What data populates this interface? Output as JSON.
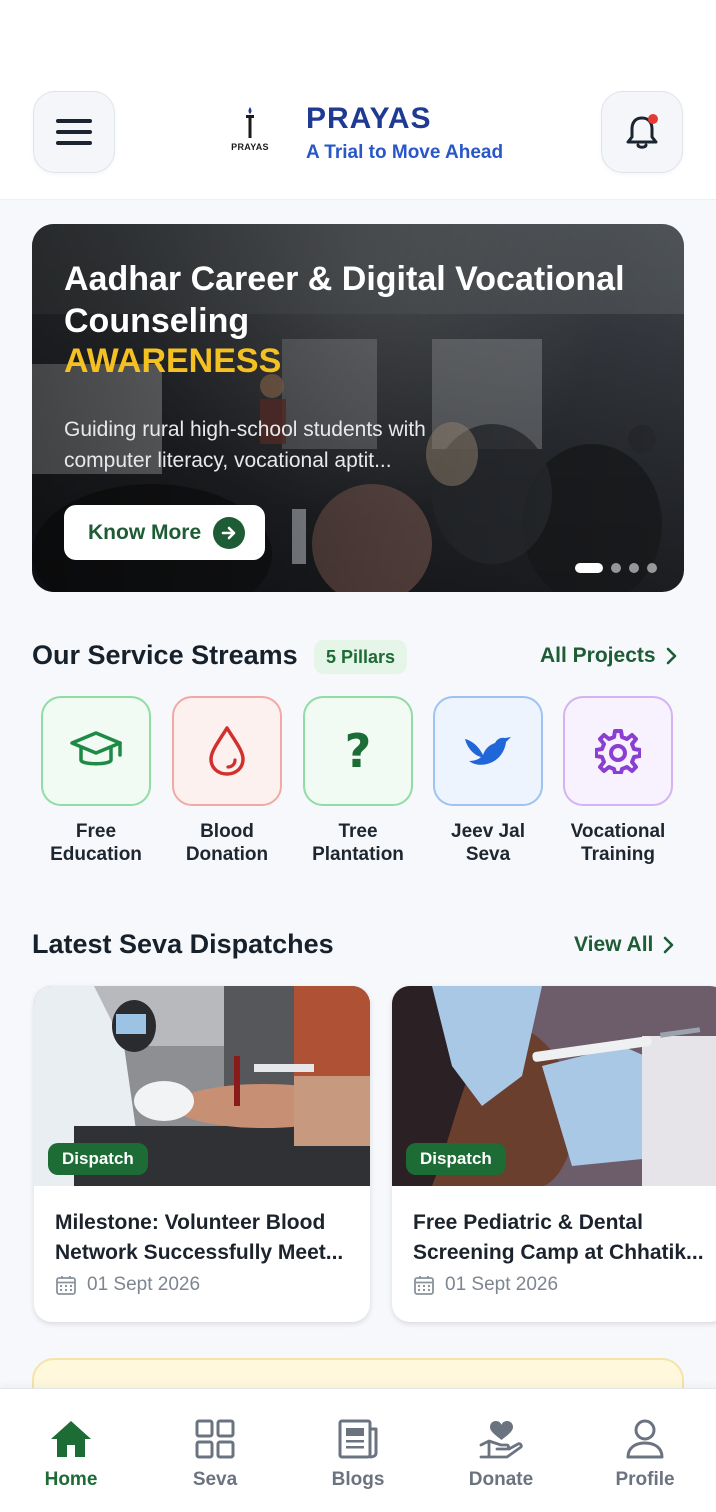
{
  "header": {
    "logo_text": "PRAYAS",
    "title": "PRAYAS",
    "subtitle": "A Trial to Move Ahead"
  },
  "hero": {
    "title": "Aadhar Career & Digital Vocational Counseling",
    "accent": "AWARENESS",
    "description": "Guiding rural high-school students with computer literacy, vocational aptit...",
    "button_label": "Know More",
    "slide_count": 4,
    "active_slide": 1
  },
  "streams": {
    "title": "Our Service Streams",
    "pill": "5 Pillars",
    "link": "All Projects",
    "items": [
      {
        "label": "Free Education",
        "icon": "graduation-cap-icon",
        "color": "#1d8a45"
      },
      {
        "label": "Blood Donation",
        "icon": "blood-drop-icon",
        "color": "#d0312d"
      },
      {
        "label": "Tree Plantation",
        "icon": "question-icon",
        "color": "#1d6b35"
      },
      {
        "label": "Jeev Jal Seva",
        "icon": "bird-icon",
        "color": "#2166d9"
      },
      {
        "label": "Vocational Training",
        "icon": "gear-icon",
        "color": "#8a3fd1"
      }
    ]
  },
  "dispatches": {
    "title": "Latest Seva Dispatches",
    "link": "View All",
    "items": [
      {
        "badge": "Dispatch",
        "title": "Milestone: Volunteer Blood Network Successfully Meet...",
        "date": "01 Sept 2026"
      },
      {
        "badge": "Dispatch",
        "title": "Free Pediatric & Dental Screening Camp at Chhatik...",
        "date": "01 Sept 2026"
      }
    ]
  },
  "nav": {
    "items": [
      {
        "label": "Home",
        "icon": "home-icon",
        "active": true
      },
      {
        "label": "Seva",
        "icon": "grid-icon",
        "active": false
      },
      {
        "label": "Blogs",
        "icon": "blogs-icon",
        "active": false
      },
      {
        "label": "Donate",
        "icon": "donate-icon",
        "active": false
      },
      {
        "label": "Profile",
        "icon": "profile-icon",
        "active": false
      }
    ]
  },
  "colors": {
    "brand_blue": "#1f3a93",
    "primary_green": "#1d6b35",
    "accent_yellow": "#f5c022"
  }
}
